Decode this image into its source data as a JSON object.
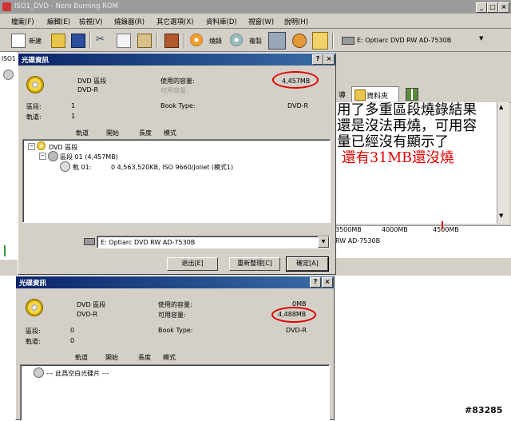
{
  "main_window": {
    "title": "ISO1_DVD - Nero Burning ROM",
    "menu": [
      "檔案(F)",
      "編輯(E)",
      "檢視(V)",
      "燒錄器(R)",
      "其它選項(X)",
      "資料庫(D)",
      "視窗(W)",
      "說明(H)"
    ],
    "toolbar": {
      "new_label": "新建",
      "burn_label": "燒錄",
      "copy_label": "複製"
    },
    "drive_combo": "E: Optiarc DVD RW AD-7530B",
    "left_tab": "ISO1",
    "tabs": [
      "導",
      "資料夾"
    ],
    "scale_labels": [
      "3500MB",
      "4000MB",
      "4500MB"
    ],
    "status_drive": "RW AD-7530B"
  },
  "annotation": {
    "line1": "用了多重區段燒錄結果",
    "line2": "還是沒法再燒，可用容",
    "line3": "量已經沒有顯示了",
    "red_line": "還有31MB還沒燒",
    "red_color": "#e00000"
  },
  "dialog1": {
    "title": "光碟資訊",
    "disc_type": "DVD 區段",
    "disc_media": "DVD-R",
    "used_label": "使用的容量:",
    "used_value": "4,457MB",
    "free_label": "可用容量:",
    "free_value": "",
    "sessions_label": "區段:",
    "sessions_value": "1",
    "tracks_label": "軌道:",
    "tracks_value": "1",
    "booktype_label": "Book Type:",
    "booktype_value": "DVD-R",
    "columns": [
      "軌道",
      "開始",
      "長度",
      "模式"
    ],
    "tree_root": "DVD 區段",
    "tree_session": "區段 01 (4,457MB)",
    "tree_track_label": "軌 01:",
    "tree_track_info": "0  4,563,520KB, ISO 9660/Joliet (模式1)",
    "drive": "E: Optiarc DVD RW AD-7530B",
    "buttons": {
      "exit": "退出[E]",
      "refresh": "重新整理[C]",
      "ok": "確定[A]"
    }
  },
  "dialog2": {
    "title": "光碟資訊",
    "disc_type": "DVD 區段",
    "disc_media": "DVD-R",
    "used_label": "使用的容量:",
    "used_value": "0MB",
    "free_label": "可用容量:",
    "free_value": "4,488MB",
    "sessions_label": "區段:",
    "sessions_value": "0",
    "tracks_label": "軌道:",
    "tracks_value": "0",
    "booktype_label": "Book Type:",
    "booktype_value": "DVD-R",
    "columns": [
      "軌道",
      "開始",
      "長度",
      "模式"
    ],
    "tree_empty": "--- 此爲空白光碟片 ---"
  },
  "watermark": "#83285"
}
